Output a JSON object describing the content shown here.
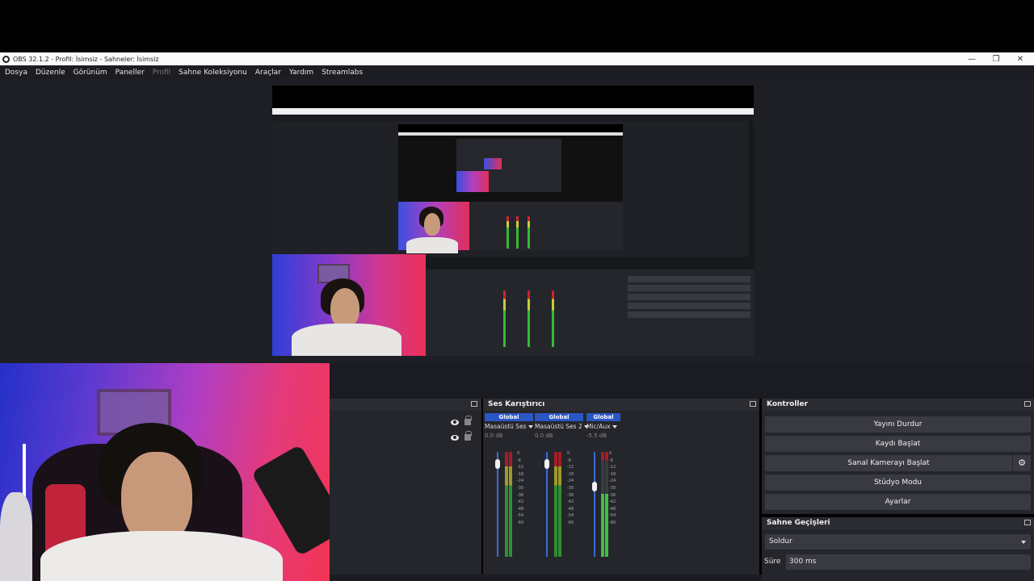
{
  "window": {
    "title": "OBS 32.1.2 - Profil: İsimsiz - Sahneler: İsimsiz",
    "controls": [
      "—",
      "❐",
      "✕"
    ]
  },
  "menu": [
    "Dosya",
    "Düzenle",
    "Görünüm",
    "Paneller",
    "Profil",
    "Sahne Koleksiyonu",
    "Araçlar",
    "Yardım",
    "Streamlabs"
  ],
  "mixer": {
    "title": "Ses Karıştırıcı",
    "channels": [
      {
        "badge": "Global",
        "name": "Masaüstü Ses",
        "db": "0.0 dB",
        "level": 1.0
      },
      {
        "badge": "Global",
        "name": "Masaüstü Ses 2",
        "db": "0.0 dB",
        "level": 1.0
      },
      {
        "badge": "Global",
        "name": "Mic/Aux",
        "db": "-5.5 dB",
        "level": 0.78
      }
    ],
    "scale": [
      "0",
      "-6",
      "-12",
      "-18",
      "-24",
      "-30",
      "-36",
      "-42",
      "-48",
      "-54",
      "-60"
    ]
  },
  "controls": {
    "title": "Kontroller",
    "buttons": [
      "Yayını Durdur",
      "Kaydı Başlat",
      "Sanal Kamerayı Başlat",
      "Stüdyo Modu",
      "Ayarlar"
    ]
  },
  "transitions": {
    "title": "Sahne Geçişleri",
    "selected": "Soldur",
    "duration_label": "Süre",
    "duration_value": "300 ms"
  },
  "colors": {
    "accent": "#2a56c6",
    "panel_bg": "#25262b",
    "button_bg": "#393a41"
  }
}
